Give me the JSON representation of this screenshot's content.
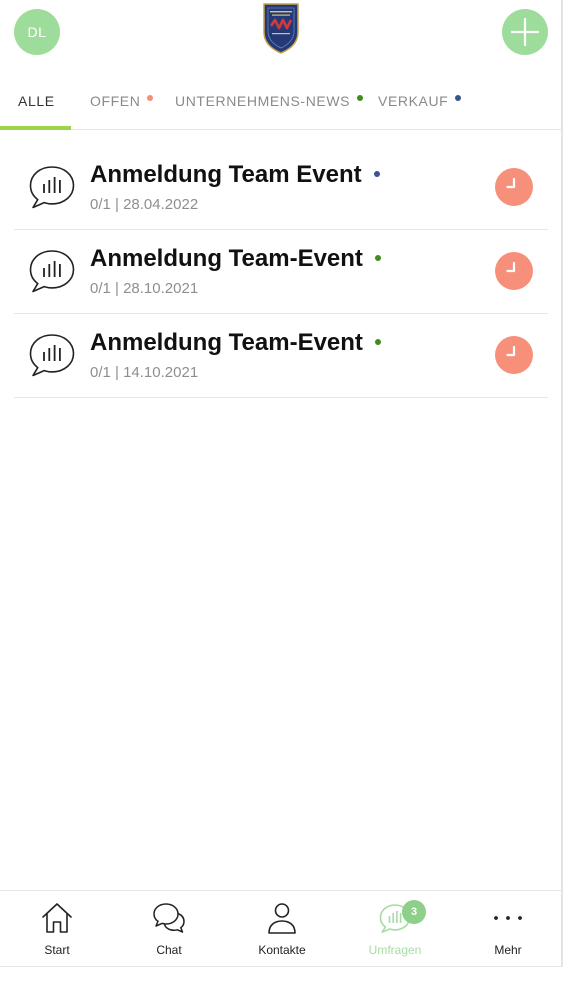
{
  "header": {
    "avatar_initials": "DL",
    "logo_icon": "shield-logo",
    "add_icon": "plus-icon"
  },
  "colors": {
    "accent_green": "#9ddc9a",
    "tab_underline": "#9ed34a",
    "dot_salmon": "#f49079",
    "dot_green": "#3f8d1c",
    "dot_blue": "#3a5490",
    "clock_salmon": "#f7907a"
  },
  "tabs": [
    {
      "label": "ALLE",
      "active": true
    },
    {
      "label": "OFFEN",
      "dot_color": "#f49079"
    },
    {
      "label": "UNTERNEHMENS-NEWS",
      "dot_color": "#3f8d1c"
    },
    {
      "label": "VERKAUF",
      "dot_color": "#3a5490"
    }
  ],
  "surveys": [
    {
      "title": "Anmeldung Team Event",
      "meta": "0/1 | 28.04.2022",
      "dot_color": "#3a5490",
      "icon": "poll-chat-icon",
      "status_icon": "clock-icon"
    },
    {
      "title": "Anmeldung Team-Event",
      "meta": "0/1 | 28.10.2021",
      "dot_color": "#3f8d1c",
      "icon": "poll-chat-icon",
      "status_icon": "clock-icon"
    },
    {
      "title": "Anmeldung Team-Event",
      "meta": "0/1 | 14.10.2021",
      "dot_color": "#3f8d1c",
      "icon": "poll-chat-icon",
      "status_icon": "clock-icon"
    }
  ],
  "nav": [
    {
      "label": "Start",
      "icon": "home-icon"
    },
    {
      "label": "Chat",
      "icon": "chat-icon"
    },
    {
      "label": "Kontakte",
      "icon": "person-icon"
    },
    {
      "label": "Umfragen",
      "icon": "poll-chat-icon",
      "active": true,
      "badge": "3"
    },
    {
      "label": "Mehr",
      "icon": "more-dots-icon"
    }
  ]
}
